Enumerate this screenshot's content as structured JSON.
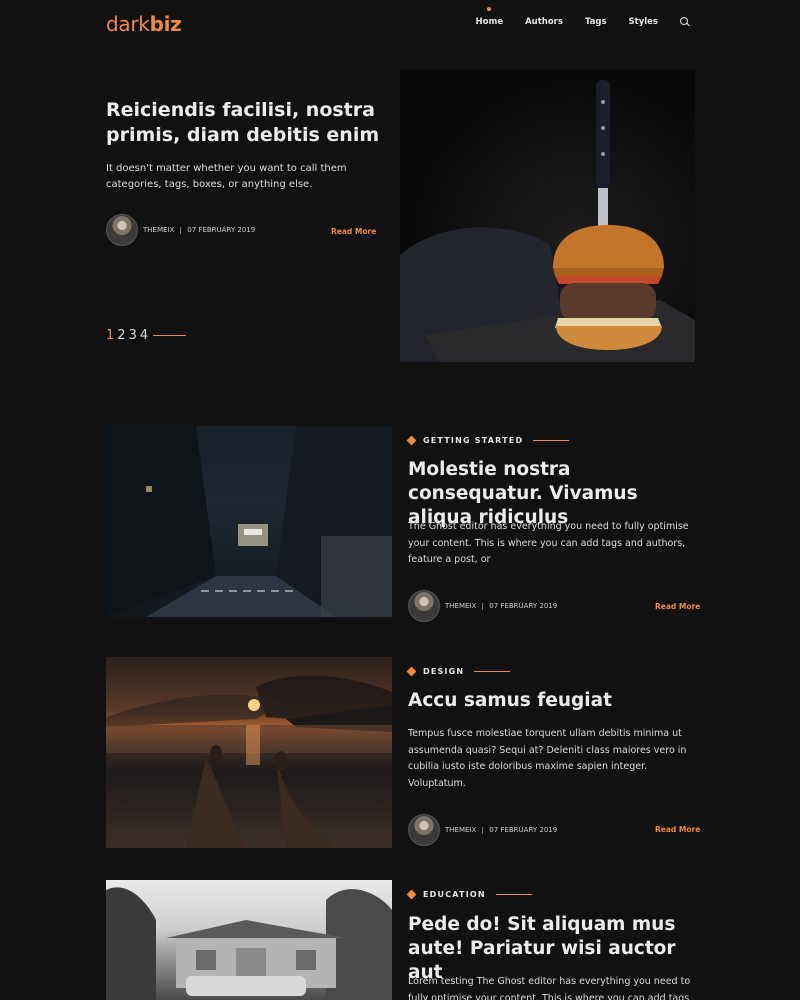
{
  "header": {
    "logo_light": "dark",
    "logo_bold": "biz",
    "nav": [
      {
        "label": "Home",
        "active": true
      },
      {
        "label": "Authors"
      },
      {
        "label": "Tags"
      },
      {
        "label": "Styles"
      }
    ],
    "search_icon": "search-icon"
  },
  "hero": {
    "title": "Reiciendis facilisi, nostra primis, diam debitis enim",
    "excerpt": "It doesn't matter whether you want to call them categories, tags, boxes, or anything else.",
    "author": "THEMEIX",
    "date": "07 FEBRUARY 2019",
    "read_more": "Read More",
    "pager": [
      "1",
      "2",
      "3",
      "4"
    ]
  },
  "posts": [
    {
      "tag": "GETTING STARTED",
      "title": "Molestie nostra consequatur. Vivamus aliqua ridiculus",
      "excerpt": "The Ghost editor has everything you need to fully optimise your content. This is where you can add tags and authors, feature a post, or",
      "author": "THEMEIX",
      "date": "07 FEBRUARY 2019",
      "read_more": "Read More"
    },
    {
      "tag": "DESIGN",
      "title": "Accu samus feugiat",
      "excerpt": "Tempus fusce molestiae torquent ullam debitis minima ut assumenda quasi? Sequi at? Deleniti class maiores vero in cubilia iusto iste doloribus maxime sapien integer. Voluptatum.",
      "author": "THEMEIX",
      "date": "07 FEBRUARY 2019",
      "read_more": "Read More"
    },
    {
      "tag": "EDUCATION",
      "title": "Pede do! Sit aliquam mus aute! Pariatur wisi auctor aut",
      "excerpt": "Lorem testing The Ghost editor has everything you need to fully optimise your content. This is where you can add tags"
    }
  ],
  "colors": {
    "accent": "#f08a3c",
    "background": "#111111",
    "text": "#e6e6e6"
  }
}
